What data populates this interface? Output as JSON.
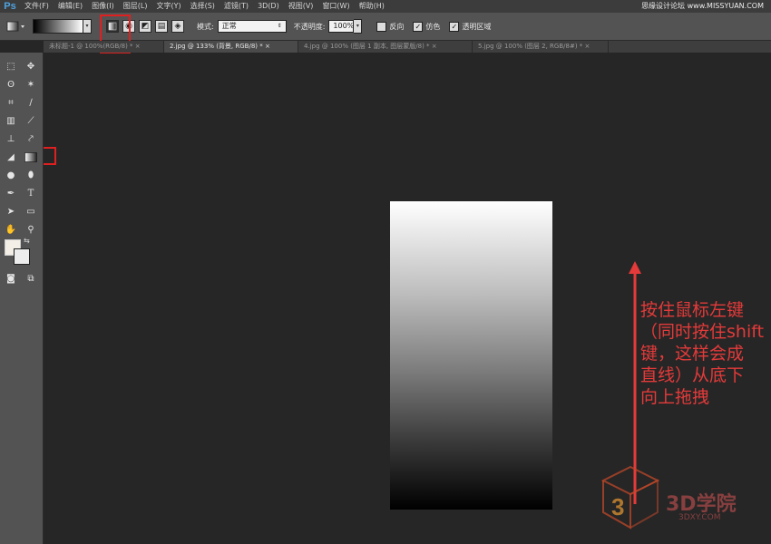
{
  "app": {
    "logo": "Ps"
  },
  "menu": [
    "文件(F)",
    "编辑(E)",
    "图像(I)",
    "图层(L)",
    "文字(Y)",
    "选择(S)",
    "滤镜(T)",
    "3D(D)",
    "视图(V)",
    "窗口(W)",
    "帮助(H)"
  ],
  "watermark_top": "思缘设计论坛  www.MISSYUAN.COM",
  "options": {
    "mode_label": "模式:",
    "mode_value": "正常",
    "opacity_label": "不透明度:",
    "opacity_value": "100%",
    "reverse_label": "反向",
    "dither_label": "仿色",
    "transparency_label": "透明区域",
    "reverse_checked": false,
    "dither_checked": true,
    "transparency_checked": true
  },
  "tabs": [
    {
      "label": "未标题-1 @ 100%(RGB/8) *",
      "close": "×",
      "active": false
    },
    {
      "label": "2.jpg @ 133% (背景, RGB/8) *",
      "close": "×",
      "active": true
    },
    {
      "label": "4.jpg @ 100% (图层 1 副本, 图层蒙版/8) *",
      "close": "×",
      "active": false
    },
    {
      "label": "5.jpg @ 100% (图层 2, RGB/8#) *",
      "close": "×",
      "active": false
    }
  ],
  "annotation": {
    "lines": [
      "按住鼠标左键",
      "（同时按住shift",
      "键，这样会成",
      "直线）从底下",
      "向上拖拽"
    ],
    "color": "#e43a3a"
  },
  "logo": {
    "name": "3D学院",
    "url": "3DXY.COM"
  },
  "colors": {
    "highlight": "#e02020",
    "canvas_bg": "#262626",
    "panel": "#535353"
  }
}
